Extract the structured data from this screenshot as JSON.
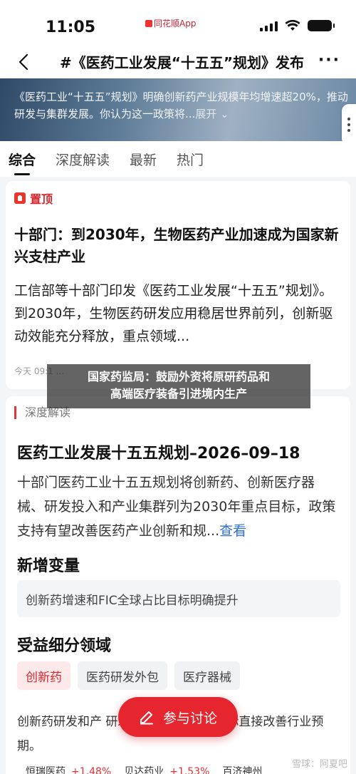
{
  "status": {
    "time": "11:05",
    "app": "同花顺App"
  },
  "nav": {
    "title": "#《医药工业发展“十五五”规划》发布",
    "more": "···"
  },
  "banner": {
    "text": "《医药工业“十五五”规划》明确创新药产业规模年均增速超20%，推动研发与集群发展。你认为这一政策将...",
    "expand": "展开 ⌄"
  },
  "tabs": [
    "综合",
    "深度解读",
    "最新",
    "热门"
  ],
  "pinned": {
    "label": "置顶",
    "title": "十部门：到2030年，生物医药产业加速成为国家新兴支柱产业",
    "body": "工信部等十部门印发《医药工业发展“十五五”规划》。到2030年，生物医药研发应用稳居世界前列，创新驱动效能充分释放，重点领域...",
    "meta": "今天 09:1 ..."
  },
  "toast": {
    "line1": "国家药监局：鼓励外资将原研药品和",
    "line2": "高端医疗装备引进境内生产"
  },
  "analysis": {
    "tag": "深度解读",
    "title": "医药工业发展十五五规划–2026–09–18",
    "body": "十部门医药工业十五五规划将创新药、创新医疗器械、研发投入和产业集群列为2030年重点目标，政策支持有望改善医药产业创新和规...",
    "see_more": "查看",
    "new_heading": "新增变量",
    "new_text": "创新药增速和FIC全球占比目标明确提升",
    "benefit_heading": "受益细分领域",
    "chips": [
      "创新药",
      "医药研发外包",
      "医疗器械"
    ],
    "foot": "创新药研发和产                研发投入及上市数量目标直接改善行业预期。"
  },
  "stocks": [
    {
      "name": "恒瑞医药",
      "pct": "+1.48%"
    },
    {
      "name": "贝达药业",
      "pct": "+1.53%"
    },
    {
      "name": "百济神州",
      "pct": ""
    }
  ],
  "discuss": {
    "label": "参与讨论"
  },
  "watermark": "雪球：阿夏吧"
}
